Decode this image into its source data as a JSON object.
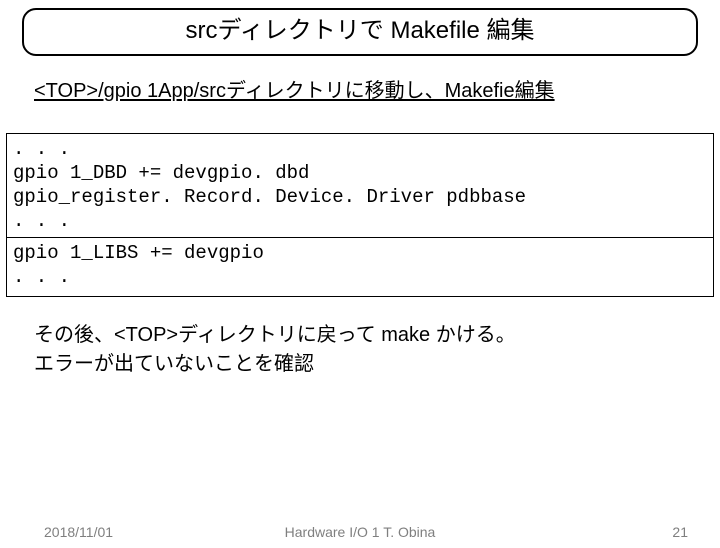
{
  "title": "srcディレクトリで Makefile 編集",
  "subtitle": "<TOP>/gpio 1App/srcディレクトリに移動し、Makefie編集",
  "code1": ". . .\ngpio 1_DBD += devgpio. dbd\ngpio_register. Record. Device. Driver pdbbase\n. . .",
  "code2": "gpio 1_LIBS += devgpio\n. . .",
  "body_line1": "その後、<TOP>ディレクトリに戻って make かける。",
  "body_line2": "エラーが出ていないことを確認",
  "footer": {
    "date": "2018/11/01",
    "center": "Hardware I/O 1 T. Obina",
    "page": "21"
  }
}
